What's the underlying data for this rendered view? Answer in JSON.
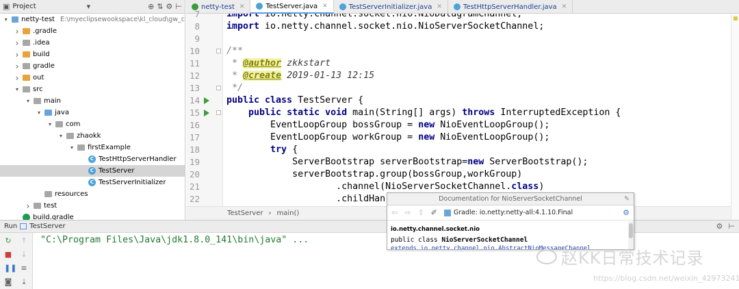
{
  "project": {
    "title": "Project",
    "tree": [
      {
        "depth": 0,
        "arrow": "down",
        "kind": "module",
        "label": "netty-test",
        "path": "E:\\myeclipsewookspace\\kl_cloud\\gw_c"
      },
      {
        "depth": 1,
        "arrow": "right",
        "kind": "folder-orange",
        "label": ".gradle"
      },
      {
        "depth": 1,
        "arrow": "right",
        "kind": "folder-gray",
        "label": ".idea"
      },
      {
        "depth": 1,
        "arrow": "right",
        "kind": "folder-orange",
        "label": "build"
      },
      {
        "depth": 1,
        "arrow": "right",
        "kind": "folder-gray",
        "label": "gradle"
      },
      {
        "depth": 1,
        "arrow": "right",
        "kind": "folder-orange",
        "label": "out"
      },
      {
        "depth": 1,
        "arrow": "down",
        "kind": "folder-gray",
        "label": "src"
      },
      {
        "depth": 2,
        "arrow": "down",
        "kind": "folder-gray",
        "label": "main"
      },
      {
        "depth": 3,
        "arrow": "down",
        "kind": "folder-blue",
        "label": "java"
      },
      {
        "depth": 4,
        "arrow": "down",
        "kind": "folder-gray",
        "label": "com"
      },
      {
        "depth": 5,
        "arrow": "down",
        "kind": "folder-gray",
        "label": "zhaokk"
      },
      {
        "depth": 6,
        "arrow": "down",
        "kind": "folder-gray",
        "label": "firstExample"
      },
      {
        "depth": 7,
        "arrow": "",
        "kind": "class",
        "label": "TestHttpServerHandler"
      },
      {
        "depth": 7,
        "arrow": "",
        "kind": "class",
        "label": "TestServer",
        "selected": true
      },
      {
        "depth": 7,
        "arrow": "",
        "kind": "class",
        "label": "TestServerInitializer"
      },
      {
        "depth": 3,
        "arrow": "",
        "kind": "folder-gray",
        "label": "resources"
      },
      {
        "depth": 2,
        "arrow": "right",
        "kind": "folder-gray",
        "label": "test"
      },
      {
        "depth": 1,
        "arrow": "",
        "kind": "gradle",
        "label": "build.gradle"
      }
    ]
  },
  "tabs": [
    {
      "label": "netty-test",
      "active": false,
      "icon_color": "#3b9b3b"
    },
    {
      "label": "TestServer.java",
      "active": true,
      "icon_color": "#4ba3d8"
    },
    {
      "label": "TestServerInitializer.java",
      "active": false,
      "icon_color": "#4ba3d8"
    },
    {
      "label": "TestHttpServerHandler.java",
      "active": false,
      "icon_color": "#4ba3d8"
    }
  ],
  "code": {
    "lines": [
      {
        "n": "7",
        "html": "<span class='kw'>import</span> io.netty.channel.socket.nio.NioDatagramChannel;"
      },
      {
        "n": "8",
        "html": "<span class='kw'>import</span> io.netty.channel.socket.nio.NioServerSocketChannel;"
      },
      {
        "n": "9",
        "html": ""
      },
      {
        "n": "10",
        "html": "<span class='cmi'>/**</span>",
        "fold": true
      },
      {
        "n": "11",
        "html": "<span class='cmi'> * </span><span class='ann'>@author</span><span class='cmv'> zkkstart</span>"
      },
      {
        "n": "12",
        "html": "<span class='cmi'> * </span><span class='ann'>@create</span><span class='cmv'> 2019-01-13 12:15</span>"
      },
      {
        "n": "13",
        "html": "<span class='cmi'> */</span>",
        "fold": true
      },
      {
        "n": "14",
        "html": "<span class='kw'>public class</span> TestServer {",
        "run": true
      },
      {
        "n": "15",
        "html": "    <span class='kw'>public static void</span> main(String[] args) <span class='kw'>throws</span> InterruptedException {",
        "run": true,
        "fold": true
      },
      {
        "n": "16",
        "html": "        EventLoopGroup bossGroup = <span class='kw'>new</span> NioEventLoopGroup();"
      },
      {
        "n": "17",
        "html": "        EventLoopGroup workGroup = <span class='kw'>new</span> NioEventLoopGroup();"
      },
      {
        "n": "18",
        "html": "        <span class='kw'>try</span> {"
      },
      {
        "n": "19",
        "html": "            ServerBootstrap serverBootstrap=<span class='kw'>new</span> ServerBootstrap();"
      },
      {
        "n": "20",
        "html": "            serverBootstrap.group(bossGroup,workGroup)"
      },
      {
        "n": "21",
        "html": "                    .channel(NioServerSocketChannel.<span class='kw'>class</span>)"
      },
      {
        "n": "22",
        "html": "                    .childHan"
      }
    ]
  },
  "breadcrumb": {
    "class_name": "TestServer",
    "separator": "›",
    "method": "main()"
  },
  "doc_popup": {
    "title": "Documentation for NioServerSocketChannel",
    "gradle": "Gradle: io.netty:netty-all:4.1.10.Final",
    "package": "io.netty.channel.socket.nio",
    "signature_prefix": "public class ",
    "signature_name": "NioServerSocketChannel",
    "extends_line": "extends io.netty.channel.nio.AbstractNioMessageChannel"
  },
  "run": {
    "label": "Run",
    "config": "TestServer",
    "console_line": "\"C:\\Program Files\\Java\\jdk1.8.0_141\\bin\\java\" ..."
  },
  "watermark": {
    "text": "赵KK日常技术记录",
    "url": "https://blog.csdn.net/weixin_42973241"
  },
  "colors": {
    "keyword": "#000080",
    "comment": "#808080",
    "console_text": "#1f7a2c",
    "selection": "#d5d5d5",
    "run_icon": "#3b9b3b",
    "folder_orange": "#e8a33c",
    "folder_blue": "#6aa5d9",
    "folder_gray": "#a7a7a7"
  }
}
